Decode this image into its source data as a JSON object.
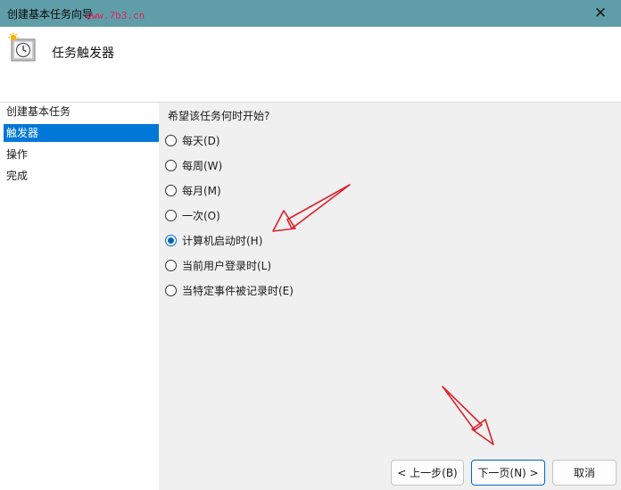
{
  "window": {
    "title": "创建基本任务向导",
    "watermark": "www.7b3.cn",
    "close_glyph": "✕"
  },
  "header": {
    "title": "任务触发器",
    "icon": "clock-icon"
  },
  "steps": [
    {
      "label": "创建基本任务",
      "selected": false
    },
    {
      "label": "触发器",
      "selected": true
    },
    {
      "label": "操作",
      "selected": false
    },
    {
      "label": "完成",
      "selected": false
    }
  ],
  "question": "希望该任务何时开始?",
  "options": [
    {
      "label": "每天(D)",
      "checked": false
    },
    {
      "label": "每周(W)",
      "checked": false
    },
    {
      "label": "每月(M)",
      "checked": false
    },
    {
      "label": "一次(O)",
      "checked": false
    },
    {
      "label": "计算机启动时(H)",
      "checked": true
    },
    {
      "label": "当前用户登录时(L)",
      "checked": false
    },
    {
      "label": "当特定事件被记录时(E)",
      "checked": false
    }
  ],
  "buttons": {
    "back": "< 上一步(B)",
    "next": "下一页(N) >",
    "cancel": "取消"
  },
  "colors": {
    "titlebar": "#5f9ea8",
    "selection": "#0078d7",
    "annotation_arrow": "#e0202a"
  }
}
